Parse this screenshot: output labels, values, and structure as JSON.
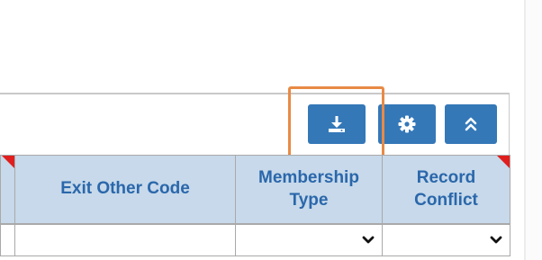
{
  "toolbar": {
    "buttons": [
      {
        "name": "download",
        "icon": "download-icon",
        "color": "#3478b8"
      },
      {
        "name": "settings",
        "icon": "gear-icon",
        "color": "#3478b8"
      },
      {
        "name": "collapse",
        "icon": "double-chevron-up-icon",
        "color": "#3478b8"
      }
    ],
    "highlight_color": "#e88a45"
  },
  "table": {
    "columns": [
      {
        "label_line1": "",
        "label_line2": ""
      },
      {
        "label_line1": "Exit Other Code",
        "label_line2": ""
      },
      {
        "label_line1": "Membership",
        "label_line2": "Type"
      },
      {
        "label_line1": "Record",
        "label_line2": "Conflict"
      }
    ],
    "filter_row": {
      "exit_other_code": "",
      "membership_type": "",
      "record_conflict": ""
    },
    "header_bg": "#c7d9ea",
    "header_text": "#2a67ab",
    "sort_marker_color": "#e01e1e"
  }
}
